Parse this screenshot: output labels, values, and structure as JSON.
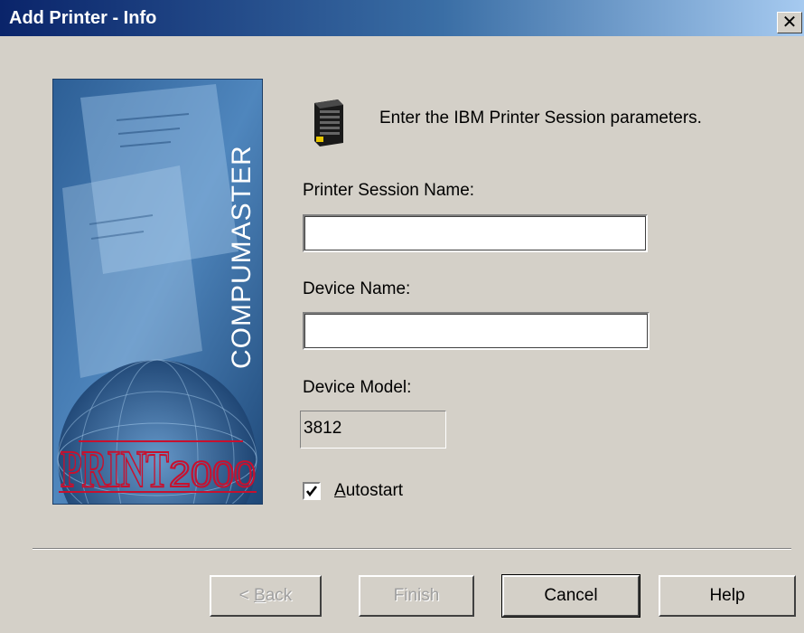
{
  "window": {
    "title": "Add Printer - Info",
    "close_glyph": "✕"
  },
  "banner": {
    "brand_vertical": "COMPUMASTER",
    "logo_text": "PRINT",
    "logo_suffix": "2000",
    "colors": {
      "background": "#3a6ea5",
      "logo": "#c8102e"
    }
  },
  "intro": {
    "icon": "printer-icon",
    "text": "Enter the IBM Printer Session parameters."
  },
  "fields": {
    "session_name": {
      "label": "Printer Session Name:",
      "value": ""
    },
    "device_name": {
      "label": "Device Name:",
      "value": ""
    },
    "device_model": {
      "label": "Device Model:",
      "value": "3812"
    }
  },
  "autostart": {
    "label_mnemonic": "A",
    "label_rest": "utostart",
    "checked": true
  },
  "buttons": {
    "back": {
      "prefix": "< ",
      "mnemonic": "B",
      "rest": "ack"
    },
    "finish": "Finish",
    "cancel": "Cancel",
    "help": "Help"
  }
}
